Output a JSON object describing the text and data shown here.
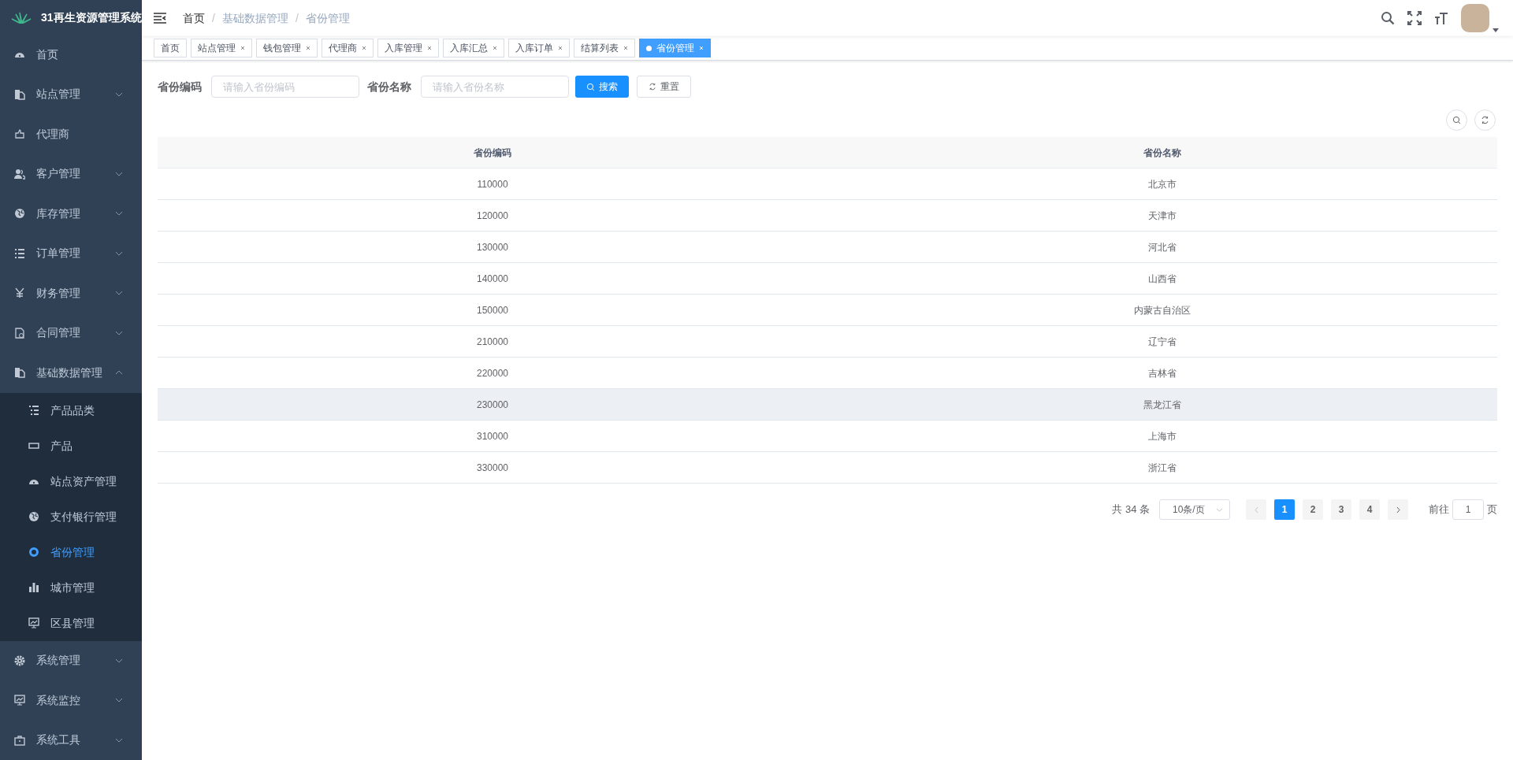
{
  "app": {
    "title": "31再生资源管理系统"
  },
  "sidebar": {
    "items": [
      {
        "label": "首页",
        "selected": false
      },
      {
        "label": "站点管理",
        "expanded": false,
        "selected": false
      },
      {
        "label": "代理商",
        "selected": false
      },
      {
        "label": "客户管理",
        "expanded": false,
        "selected": false
      },
      {
        "label": "库存管理",
        "expanded": false,
        "selected": false
      },
      {
        "label": "订单管理",
        "expanded": false,
        "selected": false
      },
      {
        "label": "财务管理",
        "expanded": false,
        "selected": false
      },
      {
        "label": "合同管理",
        "expanded": false,
        "selected": false
      },
      {
        "label": "基础数据管理",
        "expanded": true,
        "selected": false,
        "children": [
          {
            "label": "产品品类",
            "selected": false
          },
          {
            "label": "产品",
            "selected": false
          },
          {
            "label": "站点资产管理",
            "selected": false
          },
          {
            "label": "支付银行管理",
            "selected": false
          },
          {
            "label": "省份管理",
            "selected": true
          },
          {
            "label": "城市管理",
            "selected": false
          },
          {
            "label": "区县管理",
            "selected": false
          }
        ]
      },
      {
        "label": "系统管理",
        "expanded": false,
        "selected": false
      },
      {
        "label": "系统监控",
        "expanded": false,
        "selected": false
      },
      {
        "label": "系统工具",
        "expanded": false,
        "selected": false
      }
    ]
  },
  "breadcrumb": {
    "items": [
      "首页",
      "基础数据管理",
      "省份管理"
    ],
    "separators": [
      "/",
      "/"
    ]
  },
  "tabs": [
    {
      "label": "首页",
      "closable": false,
      "selected": false
    },
    {
      "label": "站点管理",
      "closable": true,
      "selected": false
    },
    {
      "label": "钱包管理",
      "closable": true,
      "selected": false
    },
    {
      "label": "代理商",
      "closable": true,
      "selected": false
    },
    {
      "label": "入库管理",
      "closable": true,
      "selected": false
    },
    {
      "label": "入库汇总",
      "closable": true,
      "selected": false
    },
    {
      "label": "入库订单",
      "closable": true,
      "selected": false
    },
    {
      "label": "结算列表",
      "closable": true,
      "selected": false
    },
    {
      "label": "省份管理",
      "closable": true,
      "selected": true
    }
  ],
  "search_form": {
    "fields": [
      {
        "label": "省份编码",
        "placeholder": "请输入省份编码"
      },
      {
        "label": "省份名称",
        "placeholder": "请输入省份名称"
      }
    ],
    "search_button": "搜索",
    "reset_button": "重置"
  },
  "table": {
    "columns": [
      "省份编码",
      "省份名称"
    ],
    "rows": [
      {
        "cells": [
          "110000",
          "北京市"
        ],
        "highlighted": false
      },
      {
        "cells": [
          "120000",
          "天津市"
        ],
        "highlighted": false
      },
      {
        "cells": [
          "130000",
          "河北省"
        ],
        "highlighted": false
      },
      {
        "cells": [
          "140000",
          "山西省"
        ],
        "highlighted": false
      },
      {
        "cells": [
          "150000",
          "内蒙古自治区"
        ],
        "highlighted": false
      },
      {
        "cells": [
          "210000",
          "辽宁省"
        ],
        "highlighted": false
      },
      {
        "cells": [
          "220000",
          "吉林省"
        ],
        "highlighted": false
      },
      {
        "cells": [
          "230000",
          "黑龙江省"
        ],
        "highlighted": true
      },
      {
        "cells": [
          "310000",
          "上海市"
        ],
        "highlighted": false
      },
      {
        "cells": [
          "330000",
          "浙江省"
        ],
        "highlighted": false
      }
    ]
  },
  "pagination": {
    "total": "共 34 条",
    "page_size": "10条/页",
    "pages": [
      {
        "label": "1",
        "selected": true
      },
      {
        "label": "2",
        "selected": false
      },
      {
        "label": "3",
        "selected": false
      },
      {
        "label": "4",
        "selected": false
      }
    ],
    "goto_label": "前往",
    "goto_value": "1",
    "goto_suffix": "页"
  }
}
